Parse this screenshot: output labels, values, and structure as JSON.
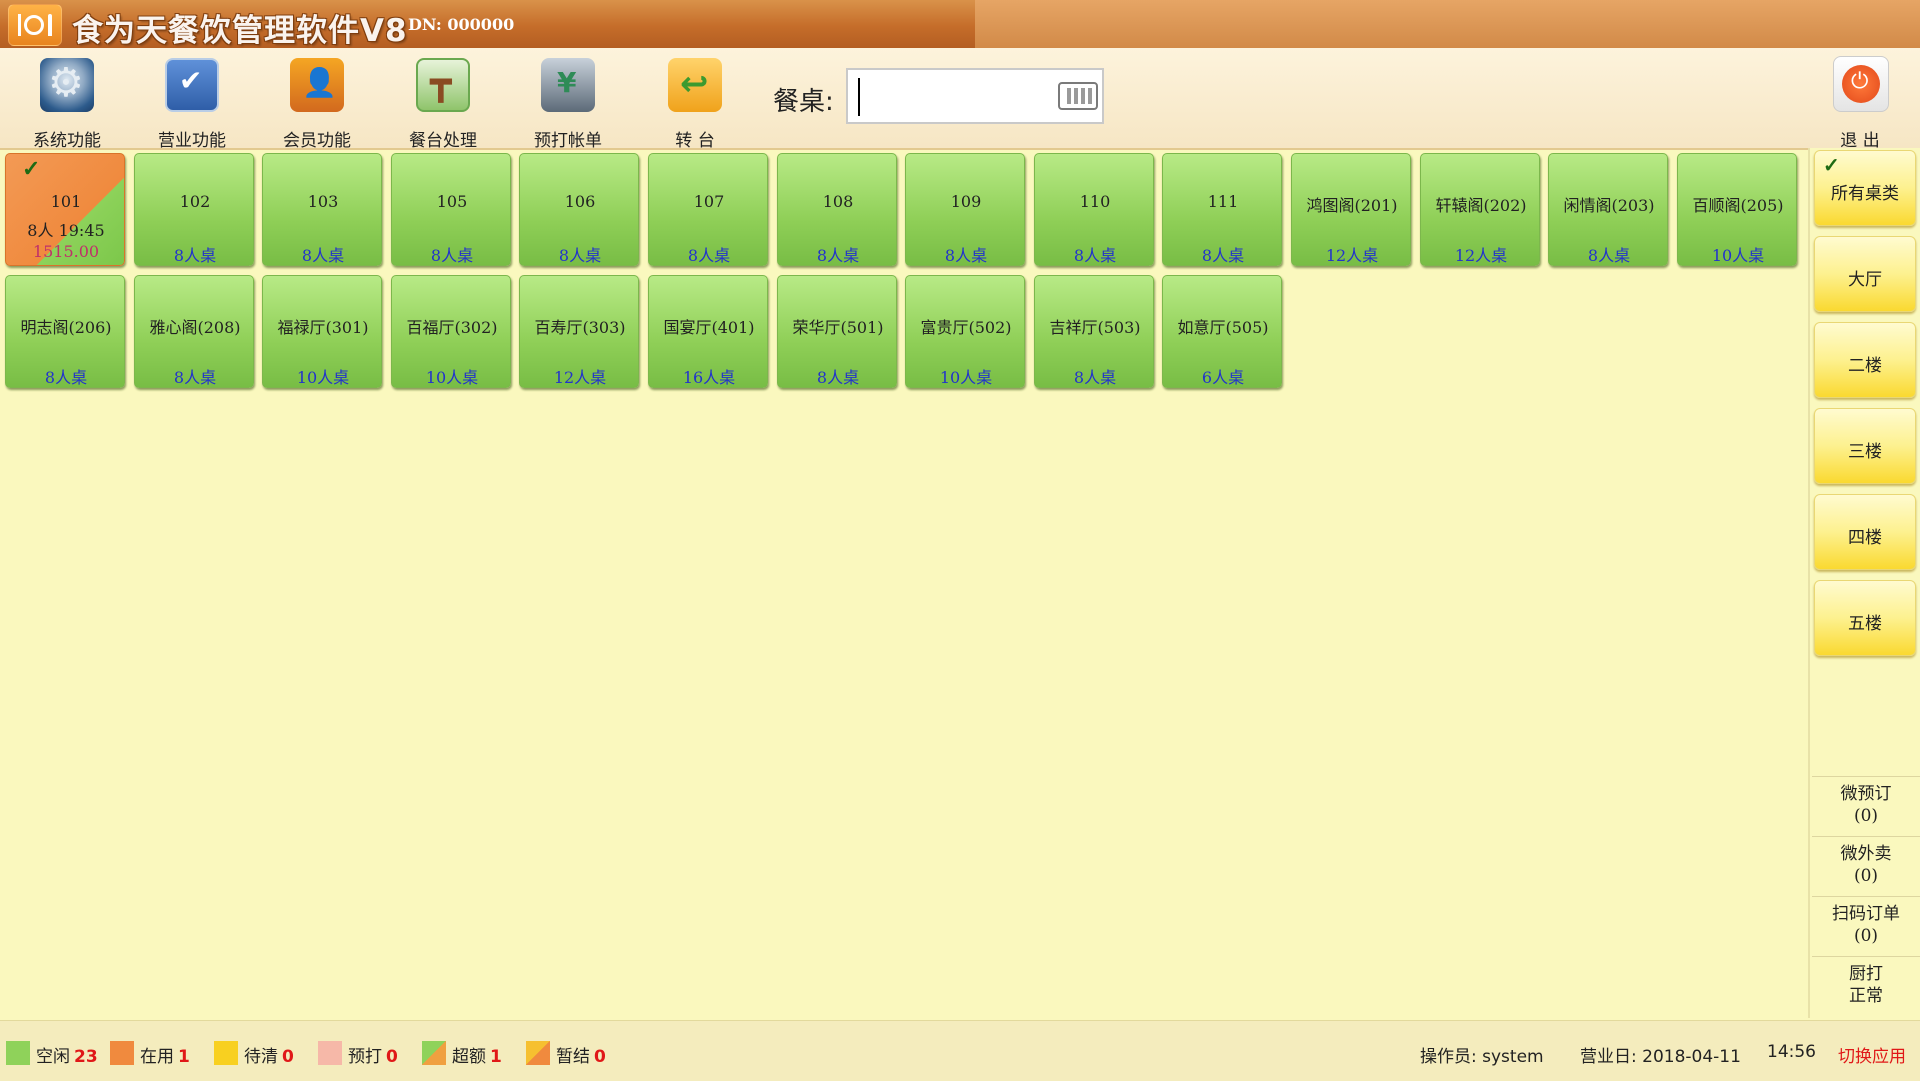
{
  "app": {
    "title": "食为天餐饮管理软件V8",
    "dn": "DN: 000000"
  },
  "toolbar": {
    "items": [
      {
        "label": "系统功能",
        "icon": "gear-icon"
      },
      {
        "label": "营业功能",
        "icon": "checkmark-icon"
      },
      {
        "label": "会员功能",
        "icon": "member-icon"
      },
      {
        "label": "餐台处理",
        "icon": "dining-table-icon"
      },
      {
        "label": "预打帐单",
        "icon": "bill-icon"
      },
      {
        "label": "转 台",
        "icon": "transfer-icon"
      }
    ],
    "search_label": "餐桌:",
    "search_value": "",
    "exit_label": "退 出"
  },
  "tables": [
    {
      "name": "101",
      "status": "在用",
      "guests_time": "8人 19:45",
      "amount": "1515.00",
      "selected": true
    },
    {
      "name": "102",
      "capacity": "8人桌"
    },
    {
      "name": "103",
      "capacity": "8人桌"
    },
    {
      "name": "105",
      "capacity": "8人桌"
    },
    {
      "name": "106",
      "capacity": "8人桌"
    },
    {
      "name": "107",
      "capacity": "8人桌"
    },
    {
      "name": "108",
      "capacity": "8人桌"
    },
    {
      "name": "109",
      "capacity": "8人桌"
    },
    {
      "name": "110",
      "capacity": "8人桌"
    },
    {
      "name": "111",
      "capacity": "8人桌"
    },
    {
      "name": "鸿图阁(201)",
      "capacity": "12人桌"
    },
    {
      "name": "轩辕阁(202)",
      "capacity": "12人桌"
    },
    {
      "name": "闲情阁(203)",
      "capacity": "8人桌"
    },
    {
      "name": "百顺阁(205)",
      "capacity": "10人桌"
    },
    {
      "name": "明志阁(206)",
      "capacity": "8人桌"
    },
    {
      "name": "雅心阁(208)",
      "capacity": "8人桌"
    },
    {
      "name": "福禄厅(301)",
      "capacity": "10人桌"
    },
    {
      "name": "百福厅(302)",
      "capacity": "10人桌"
    },
    {
      "name": "百寿厅(303)",
      "capacity": "12人桌"
    },
    {
      "name": "国宴厅(401)",
      "capacity": "16人桌"
    },
    {
      "name": "荣华厅(501)",
      "capacity": "8人桌"
    },
    {
      "name": "富贵厅(502)",
      "capacity": "10人桌"
    },
    {
      "name": "吉祥厅(503)",
      "capacity": "8人桌"
    },
    {
      "name": "如意厅(505)",
      "capacity": "6人桌"
    }
  ],
  "areas": [
    {
      "label": "所有桌类",
      "selected": true
    },
    {
      "label": "大厅"
    },
    {
      "label": "二楼"
    },
    {
      "label": "三楼"
    },
    {
      "label": "四楼"
    },
    {
      "label": "五楼"
    }
  ],
  "wechat": [
    {
      "line1": "微预订",
      "line2": "(0)"
    },
    {
      "line1": "微外卖",
      "line2": "(0)"
    },
    {
      "line1": "扫码订单",
      "line2": "(0)"
    },
    {
      "line1": "厨打",
      "line2": "正常"
    }
  ],
  "legend": [
    {
      "label": "空闲",
      "count": "23",
      "color": "#8fd25a"
    },
    {
      "label": "在用",
      "count": "1",
      "color": "#f08a3e"
    },
    {
      "label": "待清",
      "count": "0",
      "color": "#f8d020"
    },
    {
      "label": "预打",
      "count": "0",
      "color": "#f6b8a8"
    },
    {
      "label": "超额",
      "count": "1",
      "color": "#f0a040"
    },
    {
      "label": "暂结",
      "count": "0",
      "color": "#f6c030"
    }
  ],
  "status": {
    "operator": "操作员: system",
    "business_date": "营业日: 2018-04-11",
    "time": "14:56",
    "switch_app": "切换应用"
  }
}
